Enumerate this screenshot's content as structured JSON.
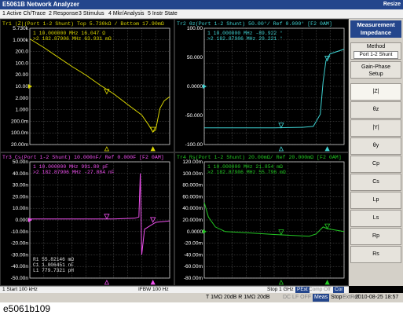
{
  "window": {
    "title": "E5061B Network Analyzer",
    "resize_label": "Resize"
  },
  "menu": [
    "1 Active Ch/Trace",
    "2 Response",
    "3 Stimulus",
    "4 Mkr/Analysis",
    "5 Instr State"
  ],
  "colors": {
    "tr1": "#d8d400",
    "tr2": "#3fd2d2",
    "tr3": "#f050f0",
    "tr4": "#23c823",
    "grid": "#5a5a5a",
    "border": "#d0d0d0",
    "axis": "#ffffff",
    "marker_arrow": "#d8d400"
  },
  "traces": [
    {
      "id": "tr1",
      "header": "Tr1 |Z|(Port 1-2 Shunt)  Top 5.730kΩ / Bottom 17.90mΩ",
      "header_badge": "Tr1",
      "ytop_label": "5.730k",
      "yaxis": [
        "1.000k",
        "100.00",
        "10.000",
        "1.0000",
        "100.0m",
        "20.00m"
      ],
      "yaxis_full": [
        "5.730k",
        "1.000k",
        "200.0",
        "100.0",
        "20.00",
        "10.00",
        "2.000",
        "1.000",
        "200.0m",
        "100.0m",
        "20.00m"
      ],
      "markers": [
        "1  10.000000 MHz  16.047 Ω",
        ">2  182.87906 MHz  63.931 mΩ"
      ],
      "chart_data": {
        "type": "line",
        "scale": "log",
        "ylim": [
          0.0179,
          5730
        ],
        "points": [
          [
            0,
            1800
          ],
          [
            0.1,
            700
          ],
          [
            0.2,
            250
          ],
          [
            0.3,
            90
          ],
          [
            0.4,
            35
          ],
          [
            0.5,
            12
          ],
          [
            0.6,
            4.5
          ],
          [
            0.7,
            1.4
          ],
          [
            0.8,
            0.45
          ],
          [
            0.85,
            0.15
          ],
          [
            0.88,
            0.07
          ],
          [
            0.9,
            0.09
          ],
          [
            0.93,
            0.9
          ],
          [
            0.96,
            2.1
          ],
          [
            1,
            3.3
          ]
        ]
      }
    },
    {
      "id": "tr2",
      "header": "Tr2 θz(Port 1-2 Shunt)  50.00°/ Ref 0.000° [F2 0AM]",
      "yaxis": [
        "100.00",
        "50.000",
        "0.0000",
        "-50.000",
        "-100.00"
      ],
      "markers": [
        "1  10.000000 MHz  -89.922 °",
        ">2  182.87906 MHz  29.221 °"
      ],
      "chart_data": {
        "type": "line",
        "ylim": [
          -125,
          125
        ],
        "points": [
          [
            0,
            -89
          ],
          [
            0.3,
            -89
          ],
          [
            0.5,
            -89
          ],
          [
            0.7,
            -88
          ],
          [
            0.78,
            -86
          ],
          [
            0.83,
            -60
          ],
          [
            0.85,
            10
          ],
          [
            0.87,
            55
          ],
          [
            0.9,
            70
          ],
          [
            1,
            80
          ]
        ]
      }
    },
    {
      "id": "tr3",
      "header": "Tr3 Cs(Port 1-2 Shunt)  10.000nF/ Ref 0.000F [F2 0AM]",
      "yaxis": [
        "50.00n",
        "40.00n",
        "30.00n",
        "20.00n",
        "10.00n",
        "0.000",
        "-10.00n",
        "-20.00n",
        "-30.00n",
        "-40.00n",
        "-50.00n"
      ],
      "markers": [
        "1  10.000000 MHz  991.80 pF",
        ">2  182.87906 MHz  -27.884 nF"
      ],
      "eq": [
        "R1  55.82146 mΩ",
        "C1  1.006451 nF",
        "L1  779.7321 pH"
      ],
      "chart_data": {
        "type": "line",
        "ylim": [
          -50,
          50
        ],
        "points": [
          [
            0,
            0.8
          ],
          [
            0.6,
            0.9
          ],
          [
            0.75,
            1.5
          ],
          [
            0.78,
            2.5
          ],
          [
            0.79,
            40
          ],
          [
            0.8,
            -30
          ],
          [
            0.82,
            -8
          ],
          [
            0.9,
            -2
          ],
          [
            1,
            -0.9
          ]
        ]
      }
    },
    {
      "id": "tr4",
      "header": "Tr4 Rs(Port 1-2 Shunt)  20.00mΩ/ Ref 20.000mΩ [F2 0AM]",
      "yaxis": [
        "120.00m",
        "100.00m",
        "80.000m",
        "60.000m",
        "40.000m",
        "20.000m",
        "0.0000",
        "-20.00m",
        "-40.00m",
        "-60.00m",
        "-80.00m"
      ],
      "markers": [
        "1  10.000000 MHz  21.854 mΩ",
        ">2  182.87906 MHz  55.796 mΩ"
      ],
      "chart_data": {
        "type": "line",
        "ylim": [
          -80,
          120
        ],
        "points": [
          [
            0,
            50
          ],
          [
            0.03,
            25
          ],
          [
            0.08,
            8
          ],
          [
            0.15,
            0
          ],
          [
            0.3,
            -2
          ],
          [
            0.5,
            -5
          ],
          [
            0.75,
            -8
          ],
          [
            0.8,
            -4
          ],
          [
            0.85,
            8
          ],
          [
            0.88,
            5
          ],
          [
            1,
            0
          ]
        ]
      }
    }
  ],
  "side_panel": {
    "title": "Measurement\nImpedance",
    "method_label": "Method",
    "method_value": "Port 1-2 Shunt",
    "gp_label": "Gain-Phase\nSetup",
    "items": [
      "|Z|",
      "θz",
      "|Y|",
      "θy",
      "Cp",
      "Cs",
      "Lp",
      "Ls",
      "Rp",
      "Rs"
    ],
    "selected": "|Z|"
  },
  "status": {
    "start": "1  Start 100 kHz",
    "ifbw": "IFBW 100 Hz",
    "stop": "Stop 1 GHz",
    "flags": [
      "PExt",
      "Comp Off",
      "Cor"
    ],
    "bottom_left": "T 1MΩ 20dB  R 1MΩ 20dB",
    "dc": "DC LF OFF",
    "meas": "Meas",
    "stop2": "Stop",
    "extref": "ExtRef",
    "datetime": "2010-08-25 18:57"
  },
  "caption": "e5061b109"
}
